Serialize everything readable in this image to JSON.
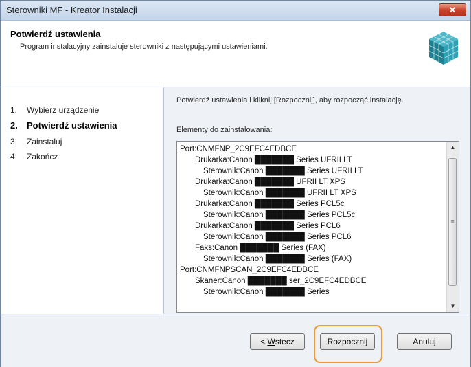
{
  "window": {
    "title": "Sterowniki MF - Kreator Instalacji"
  },
  "header": {
    "title": "Potwierdź ustawienia",
    "description": "Program instalacyjny zainstaluje sterowniki z następującymi ustawieniami."
  },
  "steps": [
    {
      "num": "1.",
      "label": "Wybierz urządzenie",
      "active": false
    },
    {
      "num": "2.",
      "label": "Potwierdź ustawienia",
      "active": true
    },
    {
      "num": "3.",
      "label": "Zainstaluj",
      "active": false
    },
    {
      "num": "4.",
      "label": "Zakończ",
      "active": false
    }
  ],
  "main": {
    "intro": "Potwierdź ustawienia i kliknij [Rozpocznij], aby rozpocząć instalację.",
    "list_label": "Elementy do zainstalowania:",
    "items": [
      "Port:CNMFNP_2C9EFC4EDBCE",
      "Drukarka:Canon ███████ Series UFRII LT",
      "Sterownik:Canon ███████ Series UFRII LT",
      "Drukarka:Canon ███████ UFRII LT XPS",
      "Sterownik:Canon ███████ UFRII LT XPS",
      "Drukarka:Canon ███████ Series PCL5c",
      "Sterownik:Canon ███████ Series PCL5c",
      "Drukarka:Canon ███████ Series PCL6",
      "Sterownik:Canon ███████ Series PCL6",
      "Faks:Canon ███████ Series (FAX)",
      "Sterownik:Canon ███████ Series (FAX)",
      "Port:CNMFNPSCAN_2C9EFC4EDBCE",
      "Skaner:Canon ███████ ser_2C9EFC4EDBCE",
      "Sterownik:Canon ███████ Series"
    ]
  },
  "buttons": {
    "back_underlined": "W",
    "back_rest": "stecz",
    "back_prefix": "< ",
    "start": "Rozpocznij",
    "cancel": "Anuluj"
  },
  "colors": {
    "highlight": "#e99a3b",
    "close_button": "#c8442b"
  }
}
